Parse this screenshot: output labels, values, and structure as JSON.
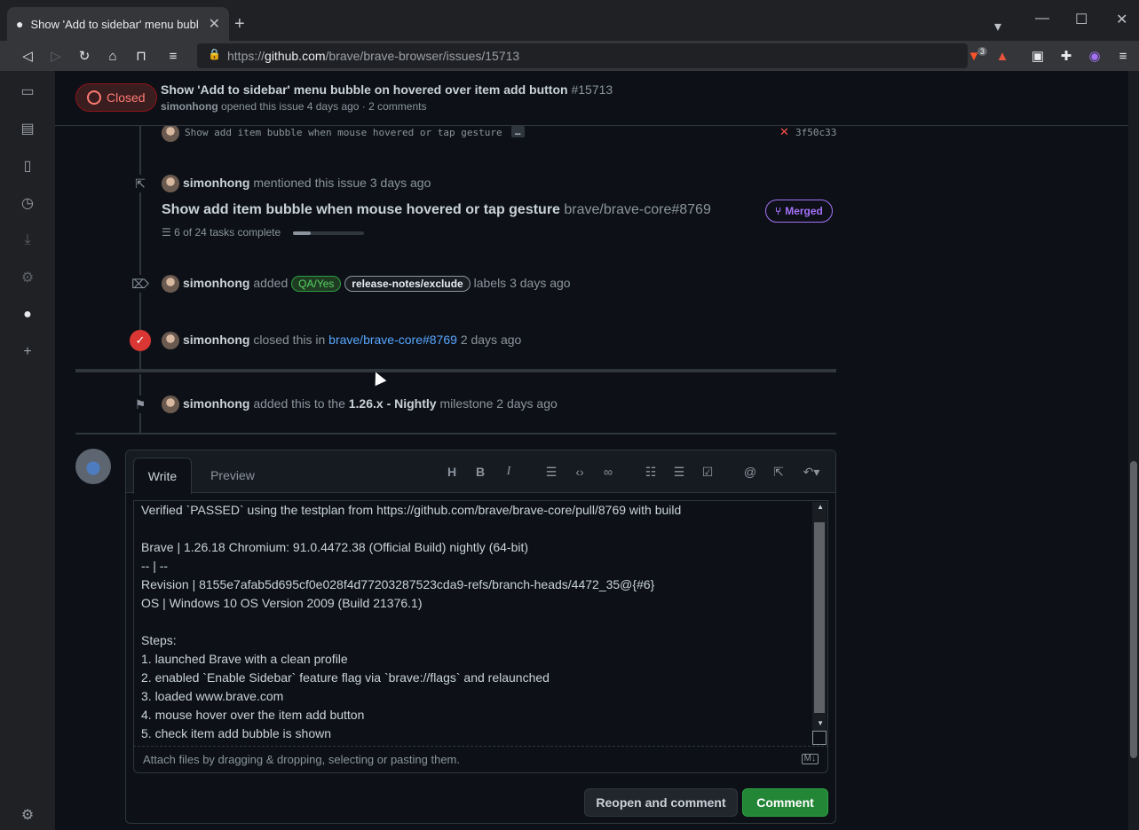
{
  "browser": {
    "tab_title": "Show 'Add to sidebar' menu bubl",
    "tab_close": "✕",
    "new_tab": "+",
    "url_scheme": "https://",
    "url_host": "github.com",
    "url_path": "/brave/brave-browser/issues/15713",
    "shield_count": "3"
  },
  "issue": {
    "status": "Closed",
    "title": "Show 'Add to sidebar' menu bubble on hovered over item add button",
    "number": "#15713",
    "author": "simonhong",
    "meta": "opened this issue 4 days ago · 2 comments"
  },
  "timeline": {
    "commit": {
      "message": "Show add item bubble when mouse hovered or tap gesture",
      "ellipsis": "…",
      "sha": "3f50c33"
    },
    "mention": {
      "user": "simonhong",
      "action": "mentioned this issue",
      "time": "3 days ago",
      "pr_title": "Show add item bubble when mouse hovered or tap gesture",
      "pr_ref": "brave/brave-core#8769",
      "tasks": "6 of 24 tasks complete",
      "tasks_progress": 0.25,
      "state": "Merged"
    },
    "labels": {
      "user": "simonhong",
      "action": "added",
      "label1": "QA/Yes",
      "label2": "release-notes/exclude",
      "suffix": "labels",
      "time": "3 days ago"
    },
    "closed": {
      "user": "simonhong",
      "action": "closed this in",
      "ref": "brave/brave-core#8769",
      "time": "2 days ago"
    },
    "milestone": {
      "user": "simonhong",
      "action": "added this to the",
      "milestone": "1.26.x - Nightly",
      "suffix": "milestone",
      "time": "2 days ago"
    }
  },
  "editor": {
    "tab_write": "Write",
    "tab_preview": "Preview",
    "body_lines": [
      "Verified `PASSED` using the testplan from https://github.com/brave/brave-core/pull/8769 with build",
      "",
      "Brave | 1.26.18 Chromium: 91.0.4472.38 (Official Build) nightly (64-bit)",
      "-- | --",
      "Revision | 8155e7afab5d695cf0e028f4d77203287523cda9-refs/branch-heads/4472_35@{#6}",
      "OS | Windows 10 OS Version 2009 (Build 21376.1)",
      "",
      "Steps:",
      "1. launched Brave with a clean profile",
      "2. enabled `Enable Sidebar` feature flag via `brave://flags` and relaunched",
      "3. loaded www.brave.com",
      "4. mouse hover over the item add button",
      "5. check item add bubble is shown"
    ],
    "attach_hint": "Attach files by dragging & dropping, selecting or pasting them.",
    "md_badge": "M↓",
    "reopen_label": "Reopen and comment",
    "comment_label": "Comment"
  },
  "colors": {
    "accent_green": "#238636",
    "closed_red": "#ff7b72",
    "merged_purple": "#a371f7",
    "link_blue": "#58a6ff"
  }
}
